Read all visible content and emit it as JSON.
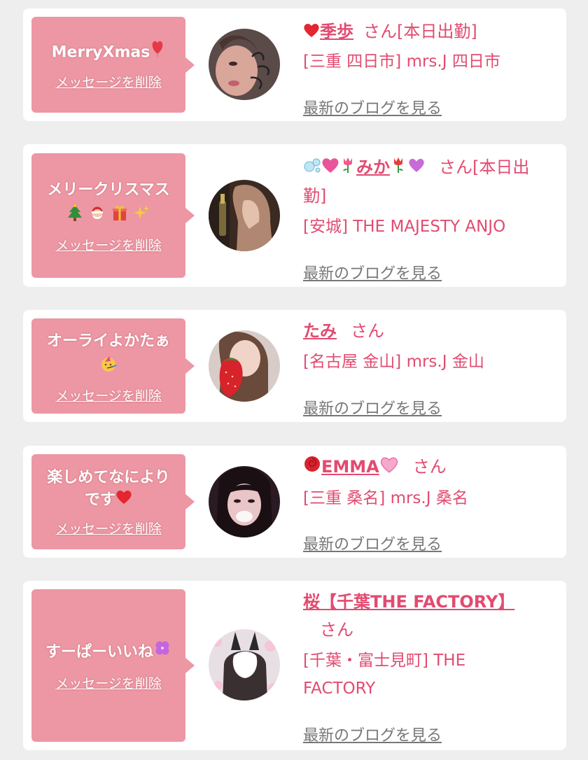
{
  "delete_label": "メッセージを削除",
  "san_label": "さん",
  "blog_label": "最新のブログを見る",
  "colors": {
    "background": "#eeeeee",
    "card": "#ffffff",
    "bubble": "#ec97a3",
    "accent": "#e24b70",
    "link_gray": "#777777"
  },
  "messages": [
    {
      "bubble_text": "MerryXmas",
      "bubble_icon": "balloon-heart-icon",
      "name": "季歩",
      "name_prefix_icon": "heart-icon",
      "status": "[本日出勤]",
      "shop": "[三重 四日市] mrs.J 四日市"
    },
    {
      "bubble_text": "メリークリスマス",
      "bubble_icons": [
        "christmas-tree-icon",
        "santa-icon",
        "gift-icon",
        "sparkles-icon"
      ],
      "name": "みか",
      "name_icons": [
        "bubbles-icon",
        "heart-icon",
        "tulip-icon",
        "tulip-icon",
        "heart-icon"
      ],
      "status": "[本日出勤]",
      "shop": "[安城] THE MAJESTY ANJO"
    },
    {
      "bubble_text": "オーライよかたぁ",
      "bubble_icon": "party-face-icon",
      "name": "たみ",
      "status": "",
      "shop": "[名古屋 金山] mrs.J 金山"
    },
    {
      "bubble_text": "楽しめてなにより",
      "bubble_text_2": "です",
      "bubble_icon": "heart-icon",
      "name": "EMMA",
      "name_icons": [
        "rose-icon",
        "heart-icon"
      ],
      "status": "",
      "shop": "[三重 桑名] mrs.J 桑名"
    },
    {
      "bubble_text": "すーぱーいいね",
      "bubble_icon": "clover-icon",
      "name": "桜【千葉THE FACTORY】",
      "status": "",
      "shop_line1": "[千葉・富士見町] THE",
      "shop_line2": "FACTORY"
    }
  ]
}
